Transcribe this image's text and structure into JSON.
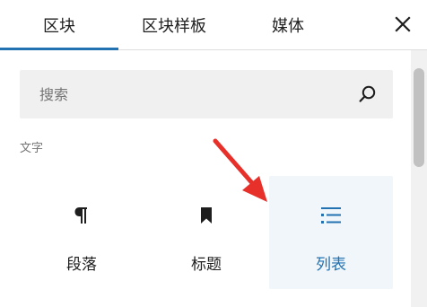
{
  "tabs": [
    {
      "label": "区块",
      "active": true
    },
    {
      "label": "区块样板",
      "active": false
    },
    {
      "label": "媒体",
      "active": false
    }
  ],
  "close_icon": "close-icon",
  "search": {
    "placeholder": "搜索",
    "value": "",
    "icon": "search-icon"
  },
  "category": {
    "label": "文字"
  },
  "blocks": [
    {
      "label": "段落",
      "icon": "paragraph-icon",
      "highlighted": false
    },
    {
      "label": "标题",
      "icon": "bookmark-icon",
      "highlighted": false
    },
    {
      "label": "列表",
      "icon": "list-icon",
      "highlighted": true
    }
  ],
  "colors": {
    "accent": "#2271b1",
    "highlight_bg": "#f0f6fa",
    "annotation_arrow": "#e8302a",
    "search_bg": "#f0f0f0"
  }
}
